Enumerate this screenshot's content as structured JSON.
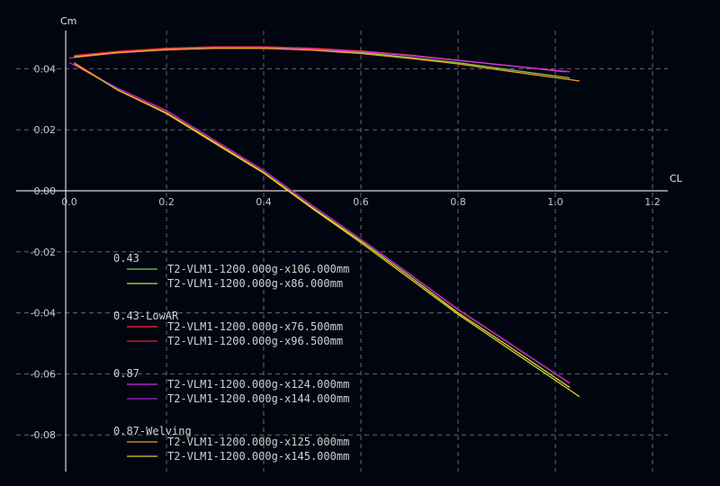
{
  "chart_data": {
    "type": "line",
    "title": "",
    "xlabel": "CL",
    "ylabel": "Cm",
    "xlim": [
      0.0,
      1.2
    ],
    "ylim": [
      -0.08,
      0.04
    ],
    "x_ticks": [
      "0.0",
      "0.2",
      "0.4",
      "0.6",
      "0.8",
      "1.0",
      "1.2"
    ],
    "y_ticks": [
      "0.04",
      "0.02",
      "0.00",
      "-0.02",
      "-0.04",
      "-0.06",
      "-0.08"
    ],
    "grid": true,
    "legend_position": "bottom-left",
    "groups": [
      {
        "name": "0.43",
        "series": [
          {
            "name": "T2-VLM1-1200.000g-x106.000mm",
            "color": "#7fd24a",
            "points": [
              [
                0.01,
                0.044
              ],
              [
                0.1,
                0.0455
              ],
              [
                0.2,
                0.0465
              ],
              [
                0.3,
                0.047
              ],
              [
                0.4,
                0.047
              ],
              [
                0.5,
                0.0463
              ],
              [
                0.6,
                0.0453
              ],
              [
                0.7,
                0.0437
              ],
              [
                0.8,
                0.042
              ],
              [
                0.9,
                0.0398
              ],
              [
                1.03,
                0.037
              ]
            ]
          },
          {
            "name": "T2-VLM1-1200.000g-x86.000mm",
            "color": "#b4e63c",
            "points": [
              [
                0.01,
                0.042
              ],
              [
                0.1,
                0.033
              ],
              [
                0.2,
                0.0255
              ],
              [
                0.3,
                0.0158
              ],
              [
                0.4,
                0.006
              ],
              [
                0.5,
                -0.0055
              ],
              [
                0.6,
                -0.0165
              ],
              [
                0.7,
                -0.028
              ],
              [
                0.8,
                -0.04
              ],
              [
                0.9,
                -0.0505
              ],
              [
                1.03,
                -0.0645
              ]
            ]
          }
        ]
      },
      {
        "name": "0.43-LowAR",
        "series": [
          {
            "name": "T2-VLM1-1200.000g-x76.500mm",
            "color": "#ff3030",
            "points": [
              [
                0.01,
                0.0443
              ],
              [
                0.1,
                0.0457
              ],
              [
                0.2,
                0.0467
              ],
              [
                0.3,
                0.0472
              ],
              [
                0.4,
                0.0472
              ],
              [
                0.5,
                0.0467
              ],
              [
                0.6,
                0.0458
              ],
              [
                0.7,
                0.0445
              ],
              [
                0.8,
                0.0428
              ],
              [
                0.9,
                0.0411
              ],
              [
                1.02,
                0.039
              ]
            ]
          },
          {
            "name": "T2-VLM1-1200.000g-x96.500mm",
            "color": "#e41e28",
            "points": [
              [
                0.01,
                0.042
              ],
              [
                0.1,
                0.0332
              ],
              [
                0.2,
                0.026
              ],
              [
                0.3,
                0.0162
              ],
              [
                0.4,
                0.0065
              ],
              [
                0.5,
                -0.005
              ],
              [
                0.6,
                -0.016
              ],
              [
                0.7,
                -0.0274
              ],
              [
                0.8,
                -0.0391
              ],
              [
                0.9,
                -0.0495
              ],
              [
                1.03,
                -0.0632
              ]
            ]
          }
        ]
      },
      {
        "name": "0.87",
        "series": [
          {
            "name": "T2-VLM1-1200.000g-x124.000mm",
            "color": "#c832e6",
            "points": [
              [
                0.0,
                0.0435
              ],
              [
                0.1,
                0.0452
              ],
              [
                0.2,
                0.0462
              ],
              [
                0.3,
                0.0468
              ],
              [
                0.4,
                0.0469
              ],
              [
                0.5,
                0.0464
              ],
              [
                0.6,
                0.0456
              ],
              [
                0.7,
                0.0443
              ],
              [
                0.8,
                0.0427
              ],
              [
                0.9,
                0.0411
              ],
              [
                1.03,
                0.039
              ]
            ]
          },
          {
            "name": "T2-VLM1-1200.000g-x144.000mm",
            "color": "#a028d2",
            "points": [
              [
                0.0,
                0.042
              ],
              [
                0.1,
                0.0336
              ],
              [
                0.2,
                0.0263
              ],
              [
                0.3,
                0.0165
              ],
              [
                0.4,
                0.0067
              ],
              [
                0.5,
                -0.0048
              ],
              [
                0.6,
                -0.0158
              ],
              [
                0.7,
                -0.0272
              ],
              [
                0.8,
                -0.0388
              ],
              [
                0.9,
                -0.0493
              ],
              [
                1.03,
                -0.063
              ]
            ]
          }
        ]
      },
      {
        "name": "0.87-Welving",
        "series": [
          {
            "name": "T2-VLM1-1200.000g-x125.000mm",
            "color": "#f0a01e",
            "points": [
              [
                0.01,
                0.0438
              ],
              [
                0.1,
                0.0453
              ],
              [
                0.2,
                0.0462
              ],
              [
                0.3,
                0.0467
              ],
              [
                0.4,
                0.0467
              ],
              [
                0.5,
                0.0461
              ],
              [
                0.6,
                0.045
              ],
              [
                0.7,
                0.0434
              ],
              [
                0.8,
                0.0416
              ],
              [
                0.9,
                0.0393
              ],
              [
                1.05,
                0.036
              ]
            ]
          },
          {
            "name": "T2-VLM1-1200.000g-x145.000mm",
            "color": "#e6c828",
            "points": [
              [
                0.01,
                0.0417
              ],
              [
                0.1,
                0.033
              ],
              [
                0.2,
                0.0253
              ],
              [
                0.3,
                0.0155
              ],
              [
                0.4,
                0.0058
              ],
              [
                0.5,
                -0.0058
              ],
              [
                0.6,
                -0.017
              ],
              [
                0.7,
                -0.0287
              ],
              [
                0.8,
                -0.0405
              ],
              [
                0.9,
                -0.0513
              ],
              [
                1.05,
                -0.0675
              ]
            ]
          }
        ]
      }
    ]
  }
}
